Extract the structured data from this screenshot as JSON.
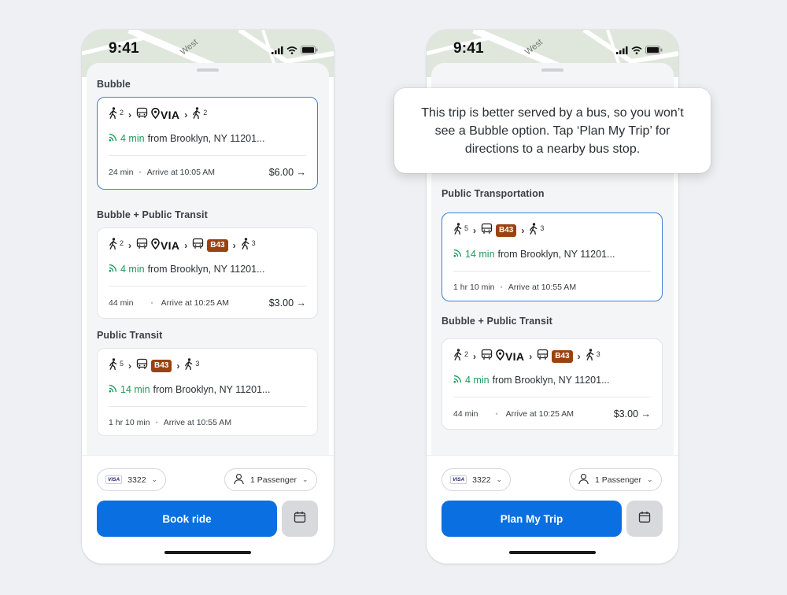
{
  "colors": {
    "primary": "#0a6fe0",
    "live_green": "#1f9a5a",
    "bus_badge": "#9a4310",
    "selected_border": "#3f7fd6"
  },
  "left": {
    "status": {
      "time": "9:41",
      "map_street": "West"
    },
    "sections": [
      {
        "title": "Bubble",
        "card": {
          "walk_before": "2",
          "via": "VIA",
          "walk_after": "2",
          "live_minutes": "4 min",
          "from": "from Brooklyn, NY 11201...",
          "duration": "24 min",
          "arrive": "Arrive at 10:05 AM",
          "price": "$6.00 →"
        }
      },
      {
        "title": "Bubble + Public Transit",
        "card": {
          "walk_before": "2",
          "via": "VIA",
          "bus": "B43",
          "walk_after": "3",
          "live_minutes": "4 min",
          "from": "from Brooklyn, NY 11201...",
          "duration": "44 min",
          "arrive": "Arrive at 10:25 AM",
          "price": "$3.00 →"
        }
      },
      {
        "title": "Public Transit",
        "card": {
          "walk_before": "5",
          "bus": "B43",
          "walk_after": "3",
          "live_minutes": "14 min",
          "from": "from Brooklyn, NY 11201...",
          "duration": "1 hr 10 min",
          "arrive": "Arrive at 10:55 AM"
        }
      }
    ],
    "payment": {
      "brand": "VISA",
      "last4": "3322"
    },
    "passengers": "1 Passenger",
    "primary_button": "Book ride"
  },
  "right": {
    "status": {
      "time": "9:41",
      "map_street": "West"
    },
    "tooltip": "This trip is better served by a bus, so you won’t see a Bubble option. Tap ‘Plan My Trip’ for directions to a nearby bus stop.",
    "sections": [
      {
        "title": "Public Transportation",
        "card": {
          "walk_before": "5",
          "bus": "B43",
          "walk_after": "3",
          "live_minutes": "14 min",
          "from": "from Brooklyn, NY 11201...",
          "duration": "1 hr 10 min",
          "arrive": "Arrive at 10:55 AM"
        }
      },
      {
        "title": "Bubble + Public Transit",
        "card": {
          "walk_before": "2",
          "via": "VIA",
          "bus": "B43",
          "walk_after": "3",
          "live_minutes": "4 min",
          "from": "from Brooklyn, NY 11201...",
          "duration": "44 min",
          "arrive": "Arrive at 10:25 AM",
          "price": "$3.00 →"
        }
      }
    ],
    "payment": {
      "brand": "VISA",
      "last4": "3322"
    },
    "passengers": "1 Passenger",
    "primary_button": "Plan My Trip"
  },
  "icons": [
    "walk-icon",
    "bus-icon",
    "via-pin-icon",
    "live-signal-icon",
    "person-icon",
    "calendar-icon",
    "chevron-down-icon",
    "signal-icon",
    "wifi-icon",
    "battery-icon"
  ]
}
